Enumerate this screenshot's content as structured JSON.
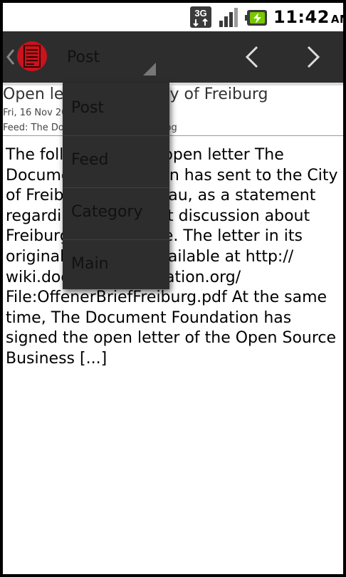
{
  "status_bar": {
    "network": "3G",
    "time": "11:42",
    "ampm": "AM",
    "battery_color": "#78c800"
  },
  "action_bar": {
    "spinner_selected": "Post",
    "accent": "#c8141e"
  },
  "post": {
    "title": "Open letter to the City of Freiburg",
    "date": "Fri, 16 Nov 2012",
    "feed": "Feed: The Document Foundation Blog",
    "body": "The following is the open letter The Document Foundation has sent to the City of Freiburg im Breisgau, as a statement regarding the current discussion about Freiburg's office suite. The letter in its original version is available at http:// wiki.documentfoundation.org/ File:OffenerBriefFreiburg.pdf At the same time, The Document Foundation has signed the open letter of the Open Source Business [...]"
  },
  "dropdown": {
    "items": [
      "Post",
      "Feed",
      "Category",
      "Main"
    ]
  }
}
